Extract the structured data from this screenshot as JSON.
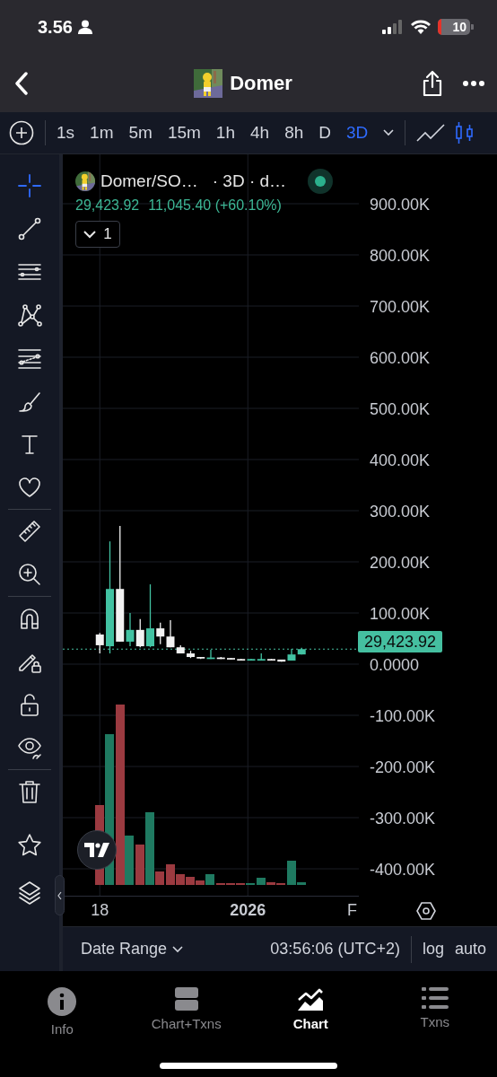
{
  "status_bar": {
    "time": "3.56",
    "battery": "10"
  },
  "header": {
    "title": "Domer"
  },
  "timeframes": [
    {
      "label": "1s",
      "selected": false
    },
    {
      "label": "1m",
      "selected": false
    },
    {
      "label": "5m",
      "selected": false
    },
    {
      "label": "15m",
      "selected": false
    },
    {
      "label": "1h",
      "selected": false
    },
    {
      "label": "4h",
      "selected": false
    },
    {
      "label": "8h",
      "selected": false
    },
    {
      "label": "D",
      "selected": false
    },
    {
      "label": "3D",
      "selected": true
    }
  ],
  "legend": {
    "symbol": "Domer/SO…",
    "interval": "· 3D · d…",
    "price": "29,423.92",
    "change": "11,045.40 (+60.10%)",
    "indicators_count": "1"
  },
  "chart_data": {
    "type": "candlestick",
    "x": [
      "2025-11-18",
      "2025-11-21",
      "2025-11-24",
      "2025-11-27",
      "2025-11-30",
      "2025-12-03",
      "2025-12-06",
      "2025-12-09",
      "2025-12-12",
      "2025-12-15",
      "2025-12-18",
      "2025-12-21",
      "2025-12-24",
      "2025-12-27",
      "2025-12-30",
      "2026-01-02",
      "2026-01-05",
      "2026-01-08",
      "2026-01-11",
      "2026-01-14",
      "2026-01-17"
    ],
    "ohlc": [
      [
        58000,
        61000,
        21000,
        37000
      ],
      [
        35000,
        240000,
        21000,
        147000
      ],
      [
        147000,
        270000,
        44000,
        44000
      ],
      [
        44000,
        100000,
        35000,
        67000
      ],
      [
        67000,
        88000,
        33000,
        35000
      ],
      [
        35000,
        156000,
        33000,
        70000
      ],
      [
        70000,
        81000,
        39000,
        54000
      ],
      [
        54000,
        86000,
        33000,
        33000
      ],
      [
        33000,
        37000,
        21000,
        21000
      ],
      [
        21000,
        26000,
        12000,
        14000
      ],
      [
        14000,
        14000,
        10000,
        11000
      ],
      [
        10000,
        28000,
        10000,
        13000
      ],
      [
        13000,
        14000,
        10000,
        10000
      ],
      [
        12000,
        12000,
        9000,
        9000
      ],
      [
        10000,
        10000,
        7000,
        7000
      ],
      [
        7000,
        10000,
        7000,
        10000
      ],
      [
        7000,
        21000,
        7000,
        10000
      ],
      [
        10000,
        10000,
        7000,
        7000
      ],
      [
        9000,
        9000,
        5000,
        5000
      ],
      [
        7000,
        30000,
        7000,
        19000
      ],
      [
        19000,
        32000,
        19000,
        29423.92
      ]
    ],
    "xticks": [
      {
        "value": "2025-11-18",
        "label": "18"
      },
      {
        "value": "2026-01-01",
        "label": "2026"
      },
      {
        "value": "2026-02-01",
        "label": "F"
      }
    ],
    "yticks": [
      {
        "value": 900000,
        "label": "900.00K"
      },
      {
        "value": 800000,
        "label": "800.00K"
      },
      {
        "value": 700000,
        "label": "700.00K"
      },
      {
        "value": 600000,
        "label": "600.00K"
      },
      {
        "value": 500000,
        "label": "500.00K"
      },
      {
        "value": 400000,
        "label": "400.00K"
      },
      {
        "value": 300000,
        "label": "300.00K"
      },
      {
        "value": 200000,
        "label": "200.00K"
      },
      {
        "value": 100000,
        "label": "100.00K"
      },
      {
        "value": 0,
        "label": "0.0000"
      },
      {
        "value": -100000,
        "label": "-100.00K"
      },
      {
        "value": -200000,
        "label": "-200.00K"
      },
      {
        "value": -300000,
        "label": "-300.00K"
      },
      {
        "value": -400000,
        "label": "-400.00K"
      }
    ],
    "xlim": [
      "2025-11-07",
      "2026-02-03"
    ],
    "ylim": [
      -452600,
      996500
    ],
    "grid": true,
    "ref_lines": [
      {
        "axis": "y",
        "value": 29423.92,
        "label": "29,423.92"
      }
    ]
  },
  "bottom_bar": {
    "date_range": "Date Range",
    "time": "03:56:06 (UTC+2)",
    "log": "log",
    "auto": "auto"
  },
  "tabs": [
    {
      "label": "Info",
      "selected": false
    },
    {
      "label": "Chart+Txns",
      "selected": false
    },
    {
      "label": "Chart",
      "selected": true
    },
    {
      "label": "Txns",
      "selected": false
    }
  ]
}
